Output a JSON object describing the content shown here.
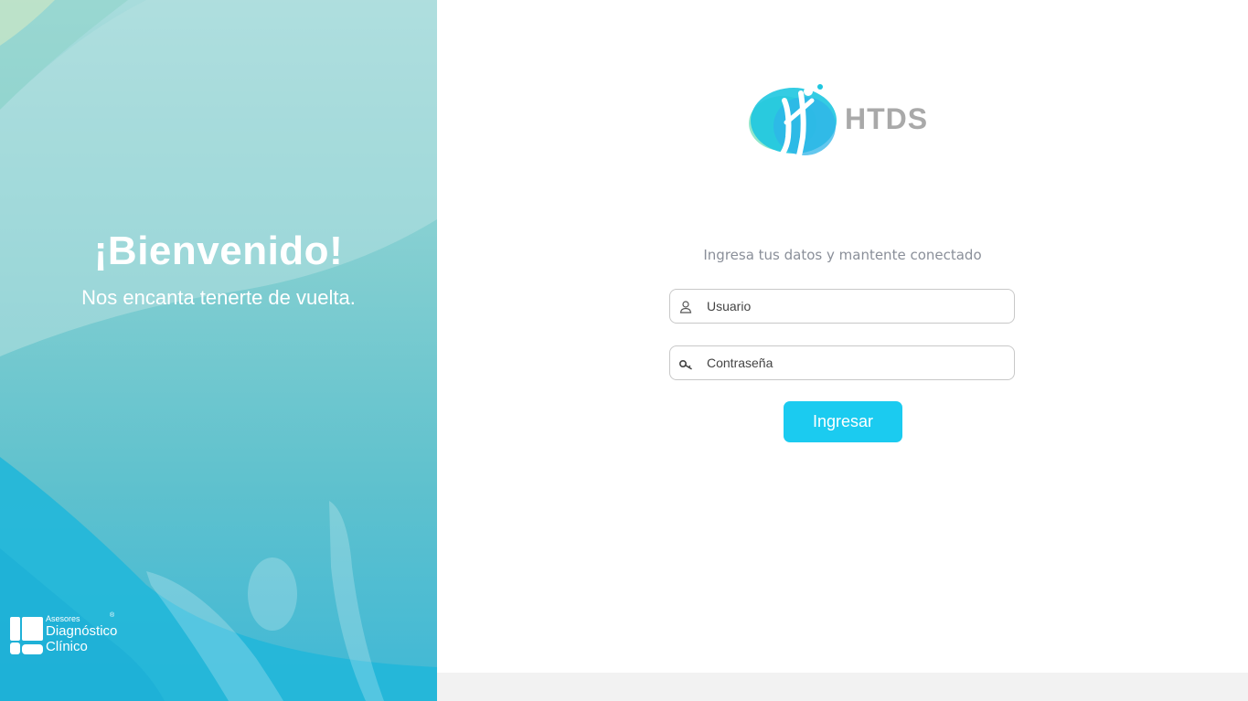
{
  "colors": {
    "accent": "#1bcbf0",
    "panel_teal": "#7fcdd0",
    "footer_gray": "#f2f2f2",
    "logo_text_gray": "#a9a9a9"
  },
  "welcome": {
    "title": "¡Bienvenido!",
    "subtitle": "Nos encanta tenerte de vuelta."
  },
  "brand": {
    "small": "Asesores",
    "line1": "Diagnóstico",
    "line2": "Clínico",
    "reg_mark": "®"
  },
  "app": {
    "logo_icon": "htds-figure-logo",
    "name": "HTDS"
  },
  "login": {
    "tagline": "Ingresa tus datos y mantente conectado",
    "username": {
      "icon": "user-icon",
      "placeholder": "Usuario",
      "value": ""
    },
    "password": {
      "icon": "key-icon",
      "placeholder": "Contraseña",
      "value": ""
    },
    "submit_label": "Ingresar"
  }
}
